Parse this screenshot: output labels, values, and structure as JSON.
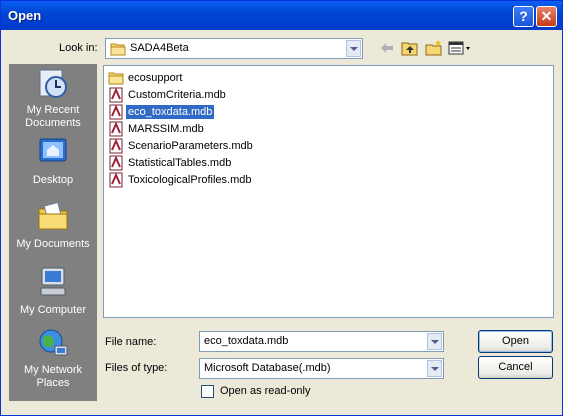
{
  "window": {
    "title": "Open"
  },
  "toolbar": {
    "look_in_label": "Look in:",
    "look_in_value": "SADA4Beta",
    "back_icon": "back-arrow-icon",
    "up_icon": "up-folder-icon",
    "new_folder_icon": "new-folder-icon",
    "views_icon": "views-menu-icon"
  },
  "places": [
    {
      "label": "My Recent Documents",
      "icon": "recent-documents-icon"
    },
    {
      "label": "Desktop",
      "icon": "desktop-icon"
    },
    {
      "label": "My Documents",
      "icon": "my-documents-icon"
    },
    {
      "label": "My Computer",
      "icon": "my-computer-icon"
    },
    {
      "label": "My Network Places",
      "icon": "network-places-icon"
    }
  ],
  "files": [
    {
      "name": "ecosupport",
      "type": "folder"
    },
    {
      "name": "CustomCriteria.mdb",
      "type": "mdb"
    },
    {
      "name": "eco_toxdata.mdb",
      "type": "mdb",
      "selected": true
    },
    {
      "name": "MARSSIM.mdb",
      "type": "mdb"
    },
    {
      "name": "ScenarioParameters.mdb",
      "type": "mdb"
    },
    {
      "name": "StatisticalTables.mdb",
      "type": "mdb"
    },
    {
      "name": "ToxicologicalProfiles.mdb",
      "type": "mdb"
    }
  ],
  "form": {
    "file_name_label": "File name:",
    "file_name_value": "eco_toxdata.mdb",
    "file_type_label": "Files of type:",
    "file_type_value": "Microsoft Database(.mdb)",
    "readonly_label": "Open as read-only",
    "readonly_checked": false
  },
  "buttons": {
    "open": "Open",
    "cancel": "Cancel"
  },
  "colors": {
    "titlebar": "#0054e3",
    "selection": "#316ac5",
    "face": "#ece9d8",
    "places_bg": "#808080"
  }
}
